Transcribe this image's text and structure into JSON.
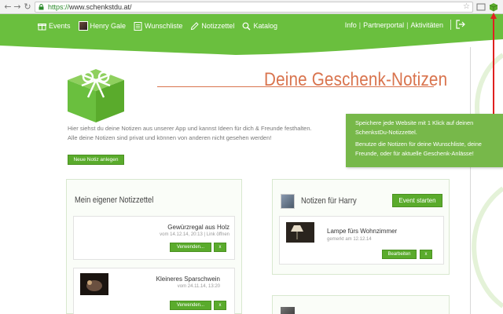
{
  "browser": {
    "url_scheme": "https://",
    "url_host": "www.schenkstdu.at/"
  },
  "nav": {
    "items": [
      {
        "label": "Events"
      },
      {
        "label": "Henry Gale"
      },
      {
        "label": "Wunschliste"
      },
      {
        "label": "Notizzettel"
      },
      {
        "label": "Katalog"
      }
    ],
    "right_items": [
      {
        "label": "Info"
      },
      {
        "label": "Partnerportal"
      },
      {
        "label": "Aktivitäten"
      }
    ]
  },
  "page": {
    "title": "Deine Geschenk-Notizen",
    "intro_line1": "Hier siehst du deine Notizen aus unserer App und kannst Ideen für dich & Freunde festhalten.",
    "intro_line2": "Alle deine Notizen sind privat und können von anderen nicht gesehen werden!",
    "new_note_button": "Neue Notiz anlegen"
  },
  "tooltip": {
    "line1": "Speichere jede Website mit 1 Klick auf deinen",
    "line2": "SchenkstDu-Notizzettel.",
    "line3": "Benutze die Notizen für deine Wunschliste, deine",
    "line4": "Freunde, oder für aktuelle Geschenk-Anlässe!"
  },
  "own_notes": {
    "title": "Mein eigener Notizzettel",
    "cards": [
      {
        "title": "Gewürzregal aus Holz",
        "meta": "vom 14.12.14, 20:13 | Link öffnen",
        "use_button": "Verwenden...",
        "delete_button": "x"
      },
      {
        "title": "Kleineres Sparschwein",
        "meta": "vom 24.11.14, 13:20",
        "use_button": "Verwenden...",
        "delete_button": "x"
      }
    ]
  },
  "harry_notes": {
    "title": "Notizen für Harry",
    "event_button": "Event starten",
    "cards": [
      {
        "title": "Lampe fürs Wohnzimmer",
        "meta": "gemerkt am 12.12.14",
        "edit_button": "Bearbeiten",
        "delete_button": "x"
      }
    ]
  },
  "colors": {
    "brand_green": "#6abf3e",
    "button_green": "#5aab2c",
    "title_orange": "#d9744e",
    "tooltip_green": "#77b84a",
    "arrow_red": "#e02020"
  }
}
